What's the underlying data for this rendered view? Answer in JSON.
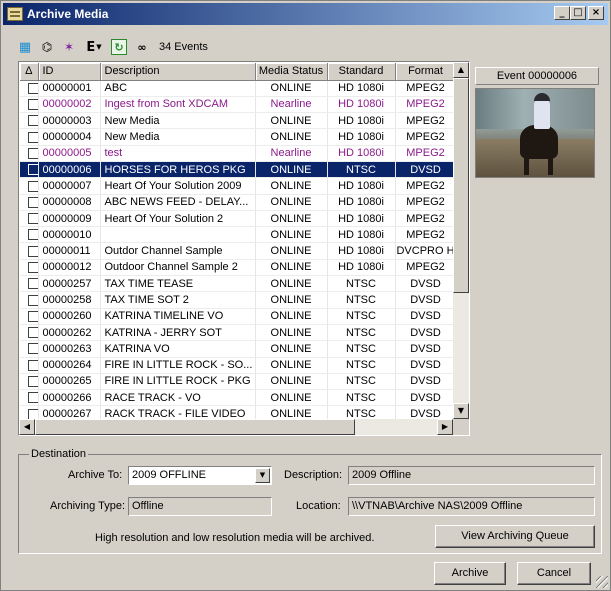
{
  "window": {
    "title": "Archive Media"
  },
  "toolbar": {
    "events_count": "34 Events",
    "e_label": "E"
  },
  "grid": {
    "columns": [
      "Δ",
      "ID",
      "Description",
      "Media Status",
      "Standard",
      "Format"
    ],
    "rows": [
      {
        "id": "00000001",
        "description": "ABC",
        "status": "ONLINE",
        "standard": "HD 1080i",
        "format": "MPEG2",
        "style": "normal"
      },
      {
        "id": "00000002",
        "description": "Ingest from Sont XDCAM",
        "status": "Nearline",
        "standard": "HD 1080i",
        "format": "MPEG2",
        "style": "nearline"
      },
      {
        "id": "00000003",
        "description": "New Media",
        "status": "ONLINE",
        "standard": "HD 1080i",
        "format": "MPEG2",
        "style": "normal"
      },
      {
        "id": "00000004",
        "description": "New Media",
        "status": "ONLINE",
        "standard": "HD 1080i",
        "format": "MPEG2",
        "style": "normal"
      },
      {
        "id": "00000005",
        "description": "test",
        "status": "Nearline",
        "standard": "HD 1080i",
        "format": "MPEG2",
        "style": "nearline"
      },
      {
        "id": "00000006",
        "description": "HORSES FOR HEROS PKG",
        "status": "ONLINE",
        "standard": "NTSC",
        "format": "DVSD",
        "style": "selected"
      },
      {
        "id": "00000007",
        "description": "Heart Of Your Solution 2009",
        "status": "ONLINE",
        "standard": "HD 1080i",
        "format": "MPEG2",
        "style": "normal"
      },
      {
        "id": "00000008",
        "description": "ABC NEWS FEED - DELAY...",
        "status": "ONLINE",
        "standard": "HD 1080i",
        "format": "MPEG2",
        "style": "normal"
      },
      {
        "id": "00000009",
        "description": "Heart Of Your Solution 2",
        "status": "ONLINE",
        "standard": "HD 1080i",
        "format": "MPEG2",
        "style": "normal"
      },
      {
        "id": "00000010",
        "description": "",
        "status": "ONLINE",
        "standard": "HD 1080i",
        "format": "MPEG2",
        "style": "normal"
      },
      {
        "id": "00000011",
        "description": "Outdor Channel Sample",
        "status": "ONLINE",
        "standard": "HD 1080i",
        "format": "DVCPRO H",
        "style": "normal"
      },
      {
        "id": "00000012",
        "description": "Outdoor Channel Sample 2",
        "status": "ONLINE",
        "standard": "HD 1080i",
        "format": "MPEG2",
        "style": "normal"
      },
      {
        "id": "00000257",
        "description": "TAX TIME TEASE",
        "status": "ONLINE",
        "standard": "NTSC",
        "format": "DVSD",
        "style": "normal"
      },
      {
        "id": "00000258",
        "description": "TAX TIME SOT 2",
        "status": "ONLINE",
        "standard": "NTSC",
        "format": "DVSD",
        "style": "normal"
      },
      {
        "id": "00000260",
        "description": "KATRINA TIMELINE VO",
        "status": "ONLINE",
        "standard": "NTSC",
        "format": "DVSD",
        "style": "normal"
      },
      {
        "id": "00000262",
        "description": "KATRINA - JERRY SOT",
        "status": "ONLINE",
        "standard": "NTSC",
        "format": "DVSD",
        "style": "normal"
      },
      {
        "id": "00000263",
        "description": "KATRINA VO",
        "status": "ONLINE",
        "standard": "NTSC",
        "format": "DVSD",
        "style": "normal"
      },
      {
        "id": "00000264",
        "description": "FIRE IN LITTLE ROCK - SO...",
        "status": "ONLINE",
        "standard": "NTSC",
        "format": "DVSD",
        "style": "normal"
      },
      {
        "id": "00000265",
        "description": "FIRE IN LITTLE ROCK - PKG",
        "status": "ONLINE",
        "standard": "NTSC",
        "format": "DVSD",
        "style": "normal"
      },
      {
        "id": "00000266",
        "description": "RACE TRACK - VO",
        "status": "ONLINE",
        "standard": "NTSC",
        "format": "DVSD",
        "style": "normal"
      },
      {
        "id": "00000267",
        "description": "RACK TRACK - FILE VIDEO",
        "status": "ONLINE",
        "standard": "NTSC",
        "format": "DVSD",
        "style": "normal"
      }
    ]
  },
  "preview": {
    "title": "Event 00000006"
  },
  "destination": {
    "group_label": "Destination",
    "archive_to_label": "Archive To:",
    "archive_to_value": "2009 OFFLINE",
    "description_label": "Description:",
    "description_value": "2009 Offline",
    "archiving_type_label": "Archiving Type:",
    "archiving_type_value": "Offline",
    "location_label": "Location:",
    "location_value": "\\\\VTNAB\\Archive NAS\\2009 Offline",
    "info_text": "High resolution and low resolution media will be archived.",
    "view_queue_label": "View Archiving Queue"
  },
  "buttons": {
    "archive_label": "Archive",
    "cancel_label": "Cancel"
  },
  "colors": {
    "selection": "#0a246a",
    "nearline_text": "#8b1a8b",
    "title_bar": "#0a246a"
  }
}
